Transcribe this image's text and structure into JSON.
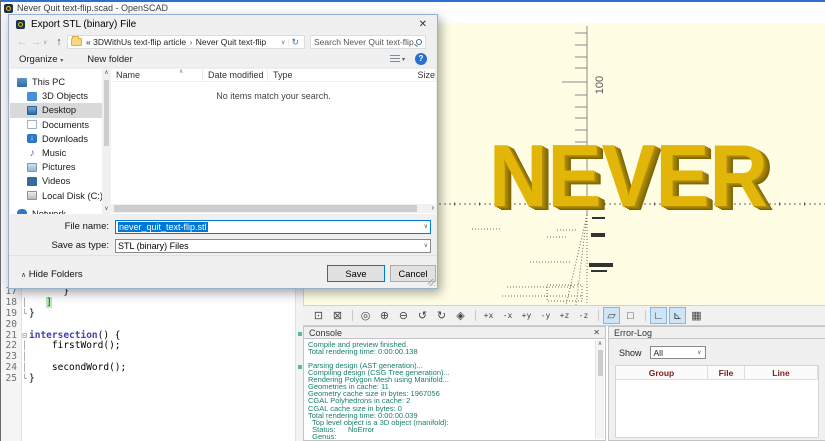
{
  "window": {
    "title": "Never Quit text-flip.scad - OpenSCAD"
  },
  "dialog": {
    "title": "Export STL (binary) File",
    "close_glyph": "✕",
    "nav": {
      "back_glyph": "←",
      "forward_glyph": "→",
      "dropdown_glyph": "∨",
      "up_glyph": "↑",
      "breadcrumb_prefix": "«",
      "breadcrumb_1": "3DWithUs text-flip article",
      "breadcrumb_sep": "›",
      "breadcrumb_2": "Never Quit text-flip",
      "refresh_glyph": "↻",
      "search_placeholder": "Search Never Quit text-flip"
    },
    "toolbar": {
      "organize_label": "Organize",
      "organize_arrow": "▾",
      "new_folder_label": "New folder",
      "view_arrow": "▾",
      "help_glyph": "?"
    },
    "columns": [
      {
        "label": "Name"
      },
      {
        "label": "Date modified"
      },
      {
        "label": "Type"
      },
      {
        "label": "Size"
      }
    ],
    "sort_glyph": "∧",
    "empty_message": "No items match your search.",
    "sidebar": [
      {
        "label": "This PC",
        "icon": "pc",
        "icon_name": "this-pc-icon",
        "indent": "root"
      },
      {
        "label": "3D Objects",
        "icon": "obj3d",
        "icon_name": "3d-objects-icon",
        "indent": "child"
      },
      {
        "label": "Desktop",
        "icon": "desktop",
        "icon_name": "desktop-icon",
        "indent": "child",
        "state": "selected"
      },
      {
        "label": "Documents",
        "icon": "documents",
        "icon_name": "documents-icon",
        "indent": "child"
      },
      {
        "label": "Downloads",
        "icon": "downloads",
        "icon_name": "downloads-icon",
        "indent": "child",
        "ig": "↓"
      },
      {
        "label": "Music",
        "icon": "music",
        "icon_name": "music-icon",
        "indent": "child",
        "ig": "♪"
      },
      {
        "label": "Pictures",
        "icon": "pictures",
        "icon_name": "pictures-icon",
        "indent": "child"
      },
      {
        "label": "Videos",
        "icon": "videos",
        "icon_name": "videos-icon",
        "indent": "child"
      },
      {
        "label": "Local Disk (C:)",
        "icon": "disk",
        "icon_name": "local-disk-icon",
        "indent": "child"
      },
      {
        "label": "Network",
        "icon": "network",
        "icon_name": "network-icon",
        "indent": "root"
      }
    ],
    "scroll_up_glyph": "∧",
    "scroll_down_glyph": "∨",
    "scroll_right_glyph": "›",
    "file_name_label": "File name:",
    "file_name_value": "never_quit_text-flip.stl",
    "save_type_label": "Save as type:",
    "save_type_value": "STL (binary) Files",
    "combo_arrow": "∨",
    "hide_folders_glyph": "∧",
    "hide_folders_label": "Hide Folders",
    "save_label": "Save",
    "cancel_label": "Cancel"
  },
  "editor": {
    "lines": [
      {
        "no": "17",
        "margin": "",
        "code": "      }"
      },
      {
        "no": "18",
        "margin": "│",
        "code": "   ",
        "match": "]"
      },
      {
        "no": "19",
        "margin": "└",
        "code": "}"
      },
      {
        "no": "20",
        "margin": "",
        "code": ""
      },
      {
        "no": "21",
        "margin": "⊟",
        "kw": "intersection",
        "code2": "() {"
      },
      {
        "no": "22",
        "margin": "│",
        "code": "    firstWord();"
      },
      {
        "no": "23",
        "margin": "│",
        "code": ""
      },
      {
        "no": "24",
        "margin": "│",
        "code": "    secondWord();"
      },
      {
        "no": "25",
        "margin": "└",
        "code": "}"
      }
    ]
  },
  "viewport": {
    "model_text": "NEVER",
    "axis_label": "100"
  },
  "view_toolbar": {
    "buttons": [
      {
        "name": "preview-button",
        "icon_name": "preview-icon",
        "glyph": "⊡"
      },
      {
        "name": "render-button",
        "icon_name": "render-icon",
        "glyph": "⊠"
      },
      {
        "name": "zoom-all-button",
        "icon_name": "zoom-all-icon",
        "glyph": "◎",
        "group": "sep"
      },
      {
        "name": "zoom-in-button",
        "icon_name": "zoom-in-icon",
        "glyph": "⊕"
      },
      {
        "name": "zoom-out-button",
        "icon_name": "zoom-out-icon",
        "glyph": "⊖"
      },
      {
        "name": "reset-rotation-button",
        "icon_name": "reset-rotation-icon",
        "glyph": "↺"
      },
      {
        "name": "reset-view-button",
        "icon_name": "reset-view-icon",
        "glyph": "↻"
      },
      {
        "name": "view-all-button",
        "icon_name": "view-all-icon",
        "glyph": "◈"
      },
      {
        "name": "view-right-button",
        "icon_name": "view-right-icon",
        "glyph": "+x",
        "group": "sep",
        "kind": "txt"
      },
      {
        "name": "view-left-button",
        "icon_name": "view-left-icon",
        "glyph": "-x",
        "kind": "txt"
      },
      {
        "name": "view-back-button",
        "icon_name": "view-back-icon",
        "glyph": "+y",
        "kind": "txt"
      },
      {
        "name": "view-front-button",
        "icon_name": "view-front-icon",
        "glyph": "-y",
        "kind": "txt"
      },
      {
        "name": "view-top-button",
        "icon_name": "view-top-icon",
        "glyph": "+z",
        "kind": "txt"
      },
      {
        "name": "view-bottom-button",
        "icon_name": "view-bottom-icon",
        "glyph": "-z",
        "kind": "txt"
      },
      {
        "name": "perspective-button",
        "icon_name": "perspective-icon",
        "glyph": "▱",
        "group": "sep",
        "state": "active"
      },
      {
        "name": "orthographic-button",
        "icon_name": "orthographic-icon",
        "glyph": "□"
      },
      {
        "name": "show-axes-button",
        "icon_name": "axes-icon",
        "glyph": "∟",
        "group": "sep",
        "state": "active"
      },
      {
        "name": "show-scale-markers-button",
        "icon_name": "scale-markers-icon",
        "glyph": "⊾",
        "state": "active"
      },
      {
        "name": "show-edges-button",
        "icon_name": "edges-icon",
        "glyph": "▦"
      }
    ]
  },
  "console": {
    "title": "Console",
    "close_glyph": "✕",
    "scroll_up_glyph": "∧",
    "lines": [
      "Compile and preview finished.",
      "Total rendering time: 0:00:00.138",
      "",
      "Parsing design (AST generation)...",
      "Compiling design (CSG Tree generation)...",
      "Rendering Polygon Mesh using Manifold...",
      "Geometries in cache: 11",
      "Geometry cache size in bytes: 1967056",
      "CGAL Polyhedrons in cache: 2",
      "CGAL cache size in bytes: 0",
      "Total rendering time: 0:00:00.039",
      "  Top level object is a 3D object (manifold):",
      "  Status:      NoError",
      "  Genus:"
    ]
  },
  "error_log": {
    "title": "Error-Log",
    "show_label": "Show",
    "filter_value": "All",
    "combo_arrow": "∨",
    "columns": [
      {
        "label": "Group"
      },
      {
        "label": "File"
      },
      {
        "label": "Line"
      },
      {
        "label": ""
      }
    ]
  }
}
